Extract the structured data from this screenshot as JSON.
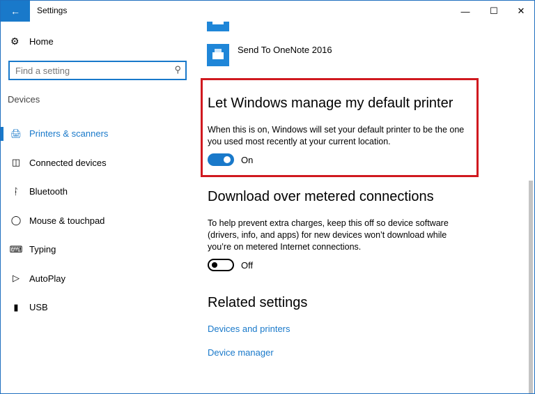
{
  "window": {
    "title": "Settings"
  },
  "titlebar": {
    "back_icon": "arrow-left",
    "minimize": "—",
    "maximize": "☐",
    "close": "✕"
  },
  "sidebar": {
    "home_label": "Home",
    "search_placeholder": "Find a setting",
    "section_label": "Devices",
    "items": [
      {
        "label": "Printers & scanners",
        "icon": "printer-icon",
        "active": true
      },
      {
        "label": "Connected devices",
        "icon": "connected-devices-icon",
        "active": false
      },
      {
        "label": "Bluetooth",
        "icon": "bluetooth-icon",
        "active": false
      },
      {
        "label": "Mouse & touchpad",
        "icon": "mouse-icon",
        "active": false
      },
      {
        "label": "Typing",
        "icon": "keyboard-icon",
        "active": false
      },
      {
        "label": "AutoPlay",
        "icon": "autoplay-icon",
        "active": false
      },
      {
        "label": "USB",
        "icon": "usb-icon",
        "active": false
      }
    ]
  },
  "main": {
    "printers": [
      {
        "name": ""
      },
      {
        "name": "Send To OneNote 2016"
      }
    ],
    "default_printer": {
      "heading": "Let Windows manage my default printer",
      "description": "When this is on, Windows will set your default printer to be the one you used most recently at your current location.",
      "toggle_state": "On"
    },
    "metered": {
      "heading": "Download over metered connections",
      "description": "To help prevent extra charges, keep this off so device software (drivers, info, and apps) for new devices won’t download while you’re on metered Internet connections.",
      "toggle_state": "Off"
    },
    "related": {
      "heading": "Related settings",
      "links": [
        "Devices and printers",
        "Device manager"
      ]
    }
  },
  "colors": {
    "accent": "#1979ca",
    "highlight_border": "#d0191f"
  }
}
